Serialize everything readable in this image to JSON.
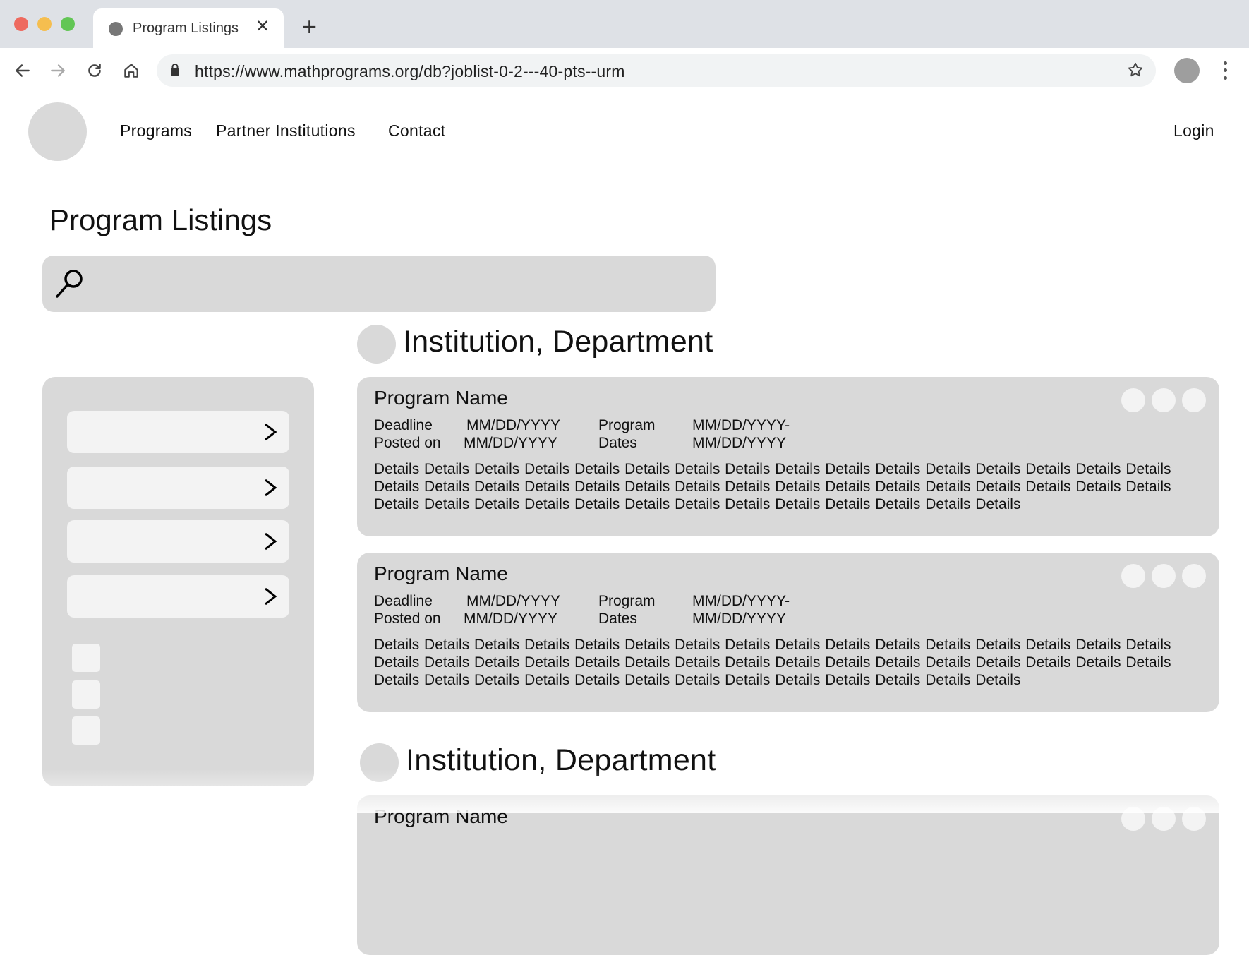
{
  "browser": {
    "tab_title": "Program Listings",
    "tab_close": "✕",
    "new_tab": "+",
    "url": "https://www.mathprograms.org/db?joblist-0-2---40-pts--urm"
  },
  "site": {
    "nav": [
      "Programs",
      "Partner Institutions",
      "Contact"
    ],
    "login": "Login"
  },
  "page": {
    "title": "Program Listings",
    "search": {
      "placeholder": ""
    }
  },
  "sidebar": {
    "filters": [
      "",
      "",
      "",
      ""
    ],
    "checkboxes": 3
  },
  "labels": {
    "deadline": "Deadline",
    "posted_on": "Posted on",
    "program": "Program",
    "dates": "Dates"
  },
  "groups": [
    {
      "heading": "Institution, Department",
      "programs": [
        {
          "name": "Program Name",
          "deadline": "MM/DD/YYYY",
          "posted_on": "MM/DD/YYYY",
          "dates_start": "MM/DD/YYYY-",
          "dates_end": "MM/DD/YYYY",
          "details": "Details Details Details Details Details Details Details Details Details Details Details Details Details Details Details Details Details Details Details Details Details Details Details Details Details Details Details Details Details Details Details Details Details Details Details Details Details Details Details Details Details Details Details Details Details"
        },
        {
          "name": "Program Name",
          "deadline": "MM/DD/YYYY",
          "posted_on": "MM/DD/YYYY",
          "dates_start": "MM/DD/YYYY-",
          "dates_end": "MM/DD/YYYY",
          "details": "Details Details Details Details Details Details Details Details Details Details Details Details Details Details Details Details Details Details Details Details Details Details Details Details Details Details Details Details Details Details Details Details Details Details Details Details Details Details Details Details Details Details Details Details Details"
        }
      ]
    },
    {
      "heading": "Institution, Department",
      "programs": [
        {
          "name": "Program Name"
        }
      ]
    }
  ]
}
